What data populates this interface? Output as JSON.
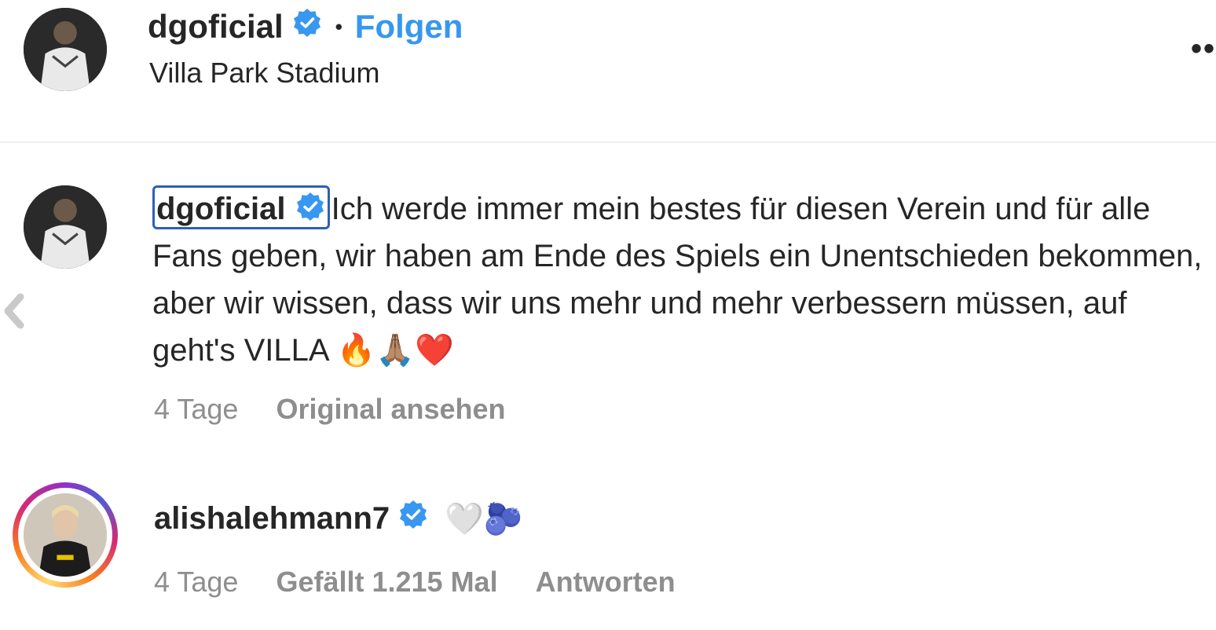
{
  "header": {
    "username": "dgoficial",
    "separator": "•",
    "follow_label": "Folgen",
    "location": "Villa Park Stadium",
    "more_label": "••"
  },
  "caption": {
    "username": "dgoficial",
    "text": "Ich werde immer mein bestes für diesen Verein und für alle Fans geben, wir haben am Ende des Spiels ein Unentschieden bekommen, aber wir wissen, dass wir uns mehr und mehr verbessern müssen, auf geht's VILLA",
    "emoji": "🔥🙏🏽❤️",
    "time": "4 Tage",
    "view_original": "Original ansehen"
  },
  "comment": {
    "username": "alishalehmann7",
    "emoji": "🤍🫐",
    "time": "4 Tage",
    "likes": "Gefällt 1.215 Mal",
    "reply": "Antworten"
  },
  "icons": {
    "verified": "verified-badge-icon",
    "prev": "chevron-left-icon"
  },
  "colors": {
    "accent": "#3797f0",
    "verified": "#3897f0",
    "muted": "#8e8e8e",
    "text": "#262626",
    "highlight_box": "#2d5fb8"
  }
}
